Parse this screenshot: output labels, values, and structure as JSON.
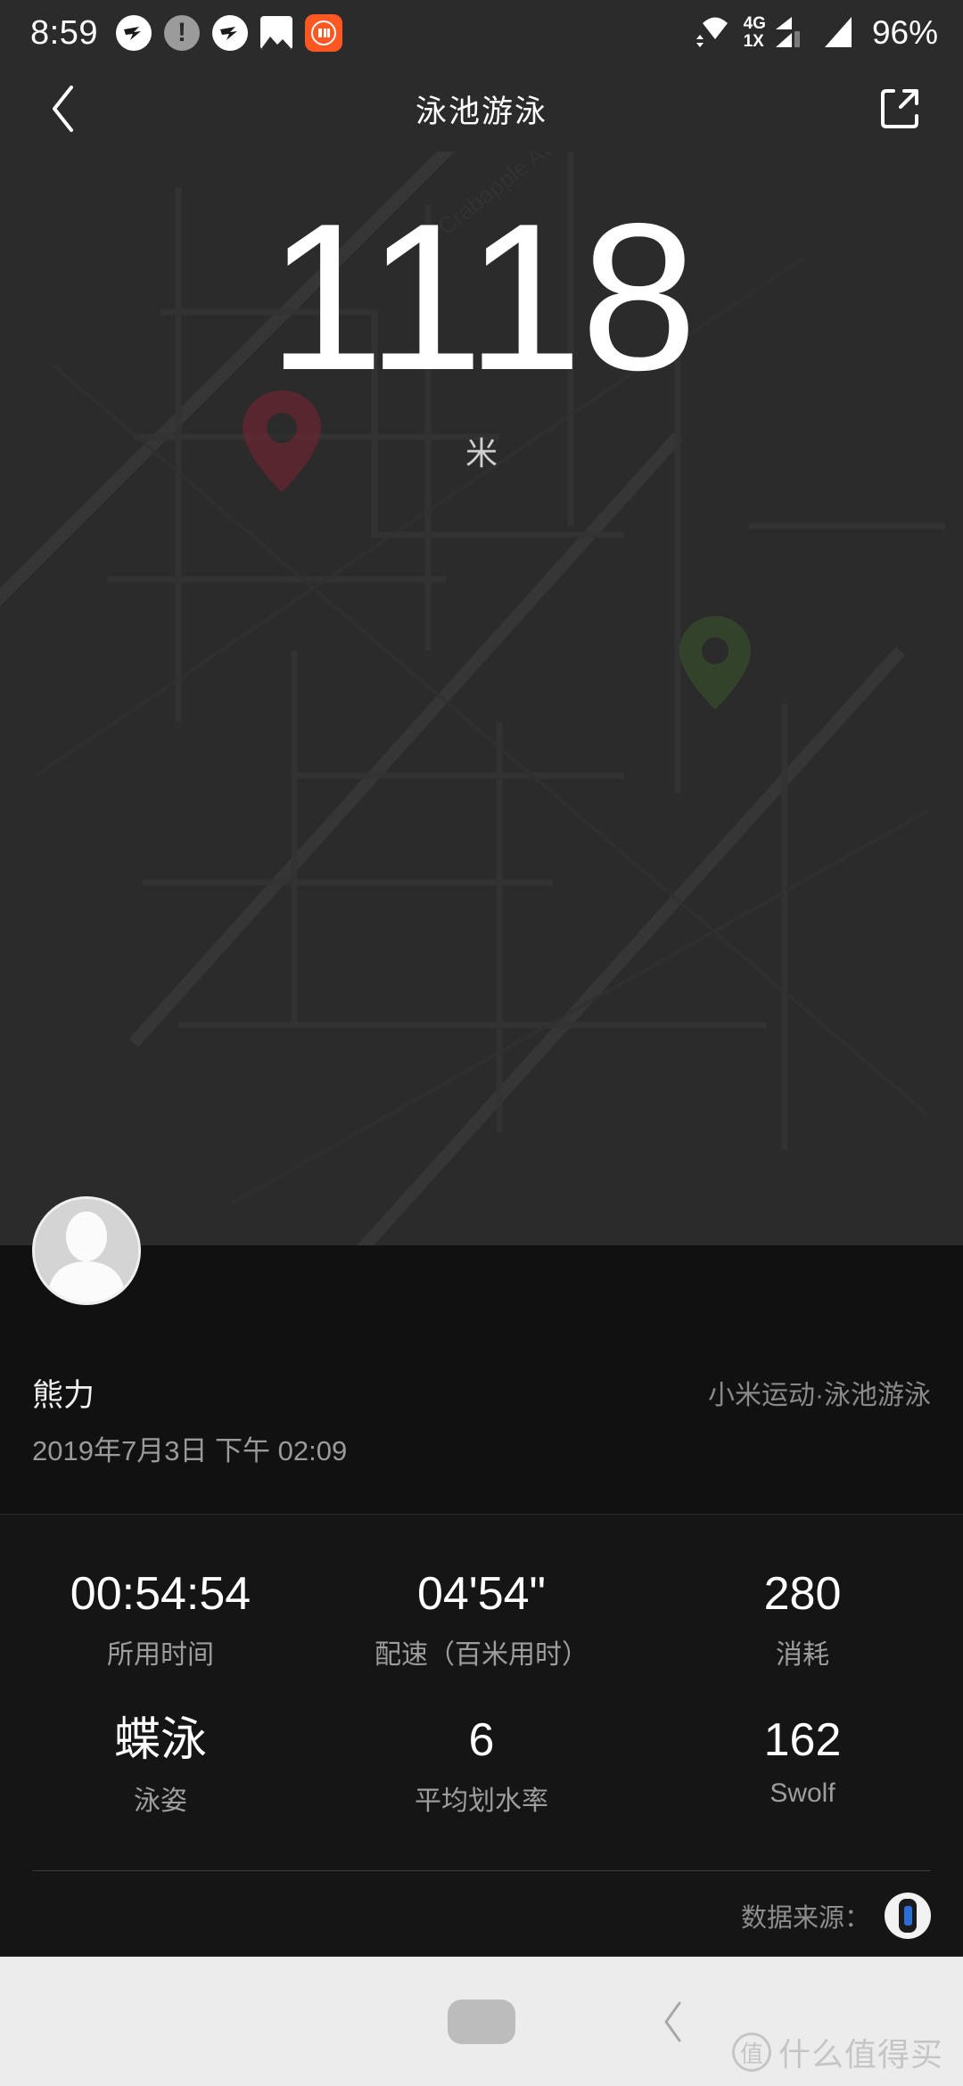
{
  "statusbar": {
    "time": "8:59",
    "battery": "96%",
    "net_primary": "4G",
    "net_secondary": "1X",
    "icons": [
      {
        "name": "app-wing-icon-1",
        "glyph": "wing"
      },
      {
        "name": "warning-icon",
        "glyph": "!"
      },
      {
        "name": "app-wing-icon-2",
        "glyph": "wing"
      },
      {
        "name": "gallery-icon",
        "glyph": "image"
      },
      {
        "name": "mi-app-icon",
        "glyph": "mi"
      }
    ]
  },
  "header": {
    "back_label": "‹",
    "title": "泳池游泳",
    "share_label": "share"
  },
  "hero": {
    "value": "1118",
    "unit": "米"
  },
  "profile": {
    "name": "熊力",
    "datetime": "2019年7月3日 下午 02:09",
    "source": "小米运动·泳池游泳"
  },
  "stats": {
    "row1": [
      {
        "value": "00:54:54",
        "label": "所用时间"
      },
      {
        "value": "04'54\"",
        "label": "配速（百米用时）"
      },
      {
        "value": "280",
        "label": "消耗"
      }
    ],
    "row2": [
      {
        "value": "蝶泳",
        "label": "泳姿"
      },
      {
        "value": "6",
        "label": "平均划水率"
      },
      {
        "value": "162",
        "label": "Swolf"
      }
    ],
    "source_label": "数据来源："
  },
  "navbar": {
    "back_label": "‹",
    "watermark_badge": "值",
    "watermark_text": "什么值得买"
  },
  "colors": {
    "page_bg": "#2b2b2b",
    "panel_bg": "#111111",
    "stats_bg": "#151515",
    "accent_orange": "#ff5722",
    "nav_bg": "#ececec"
  }
}
